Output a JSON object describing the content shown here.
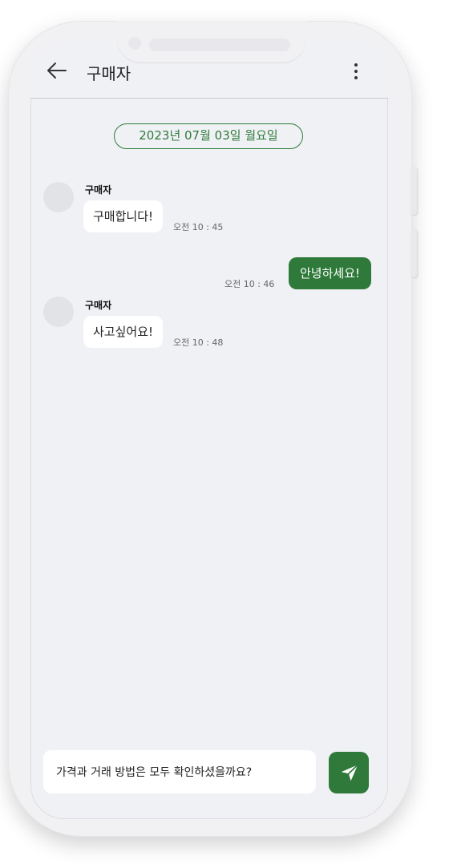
{
  "header": {
    "title": "구매자"
  },
  "chat": {
    "date_label": "2023년 07월 03일 월요일",
    "messages": [
      {
        "sender": "구매자",
        "text": "구매합니다!",
        "time": "오전 10 : 45"
      },
      {
        "text": "안녕하세요!",
        "time": "오전 10 : 46"
      },
      {
        "sender": "구매자",
        "text": "사고싶어요!",
        "time": "오전 10 : 48"
      }
    ]
  },
  "composer": {
    "value": "가격과 거래 방법은 모두 확인하셨을까요?"
  },
  "icons": {
    "back": "arrow-left-icon",
    "more": "more-vertical-icon",
    "send": "paper-plane-icon"
  },
  "colors": {
    "accent": "#2f7a3a",
    "screen_bg": "#f0f1f5",
    "bubble_in": "#ffffff"
  }
}
